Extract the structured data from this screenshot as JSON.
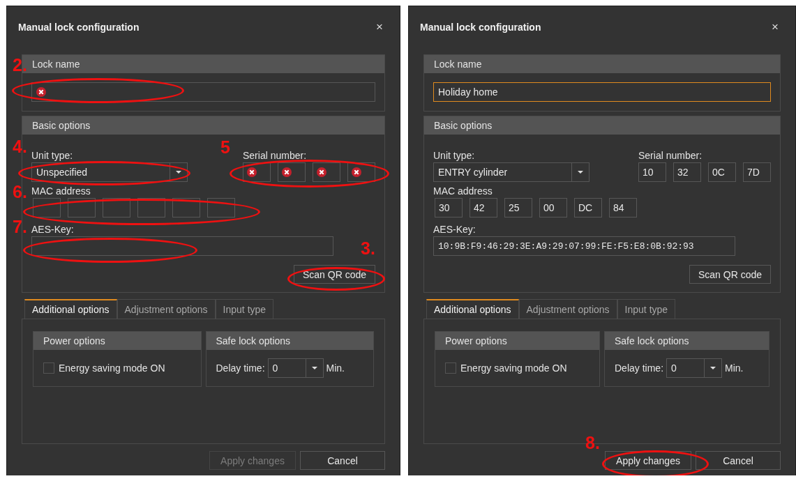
{
  "dialogs": [
    {
      "title": "Manual lock configuration",
      "close": "×",
      "lock_name": {
        "title": "Lock name",
        "error": true,
        "focused": false,
        "annotation": "2."
      },
      "basic_options": {
        "title": "Basic options",
        "unit_type": {
          "label": "Unit type:",
          "value": "Unspecified",
          "annotation": "4."
        },
        "serial_number": {
          "label": "Serial number:",
          "annotation": "5",
          "parts": [
            {
              "error": true
            },
            {
              "error": true
            },
            {
              "error": true
            },
            {
              "error": true
            }
          ]
        },
        "mac_address": {
          "label": "MAC address",
          "annotation": "6.",
          "parts": [
            {
              "error": false
            },
            {
              "error": false
            },
            {
              "error": false
            },
            {
              "error": false
            },
            {
              "error": false
            },
            {
              "error": false
            }
          ]
        },
        "aes_key": {
          "label": "AES-Key:",
          "annotation": "7."
        },
        "scan_button": {
          "label": "Scan QR code",
          "annotation": "3."
        }
      },
      "tabs": [
        {
          "label": "Additional options",
          "selected": true
        },
        {
          "label": "Adjustment options",
          "selected": false
        },
        {
          "label": "Input type",
          "selected": false
        }
      ],
      "power_options": {
        "title": "Power options",
        "energy_saving": {
          "label": "Energy saving mode ON",
          "checked": false
        }
      },
      "safe_lock_options": {
        "title": "Safe lock options",
        "delay_label": "Delay time:",
        "delay_value": "0",
        "unit": "Min."
      },
      "buttons": [
        {
          "label": "Apply changes",
          "disabled": true
        },
        {
          "label": "Cancel",
          "disabled": false
        }
      ]
    },
    {
      "title": "Manual lock configuration",
      "close": "×",
      "lock_name": {
        "title": "Lock name",
        "value": "Holiday home",
        "error": false,
        "focused": true
      },
      "basic_options": {
        "title": "Basic options",
        "unit_type": {
          "label": "Unit type:",
          "value": "ENTRY cylinder"
        },
        "serial_number": {
          "label": "Serial number:",
          "parts": [
            {
              "value": "10",
              "error": false
            },
            {
              "value": "32",
              "error": false
            },
            {
              "value": "0C",
              "error": false
            },
            {
              "value": "7D",
              "error": false
            }
          ]
        },
        "mac_address": {
          "label": "MAC address",
          "parts": [
            {
              "value": "30",
              "error": false
            },
            {
              "value": "42",
              "error": false
            },
            {
              "value": "25",
              "error": false
            },
            {
              "value": "00",
              "error": false
            },
            {
              "value": "DC",
              "error": false
            },
            {
              "value": "84",
              "error": false
            }
          ]
        },
        "aes_key": {
          "label": "AES-Key:",
          "value": "10:9B:F9:46:29:3E:A9:29:07:99:FE:F5:E8:0B:92:93"
        },
        "scan_button": {
          "label": "Scan QR code"
        }
      },
      "tabs": [
        {
          "label": "Additional options",
          "selected": true
        },
        {
          "label": "Adjustment options",
          "selected": false
        },
        {
          "label": "Input type",
          "selected": false
        }
      ],
      "power_options": {
        "title": "Power options",
        "energy_saving": {
          "label": "Energy saving mode ON",
          "checked": false
        }
      },
      "safe_lock_options": {
        "title": "Safe lock options",
        "delay_label": "Delay time:",
        "delay_value": "0",
        "unit": "Min."
      },
      "buttons": [
        {
          "label": "Apply changes",
          "disabled": false,
          "annotation": "8."
        },
        {
          "label": "Cancel",
          "disabled": false
        }
      ]
    }
  ]
}
